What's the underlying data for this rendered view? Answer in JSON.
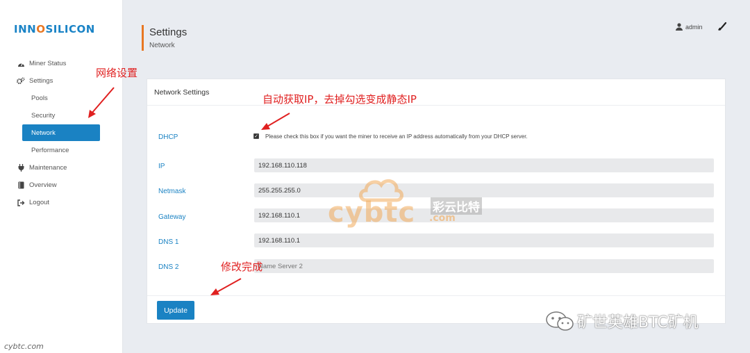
{
  "brand": {
    "logo_text": "INNOSILICON"
  },
  "sidebar": {
    "items": [
      {
        "label": "Miner Status",
        "icon": "dashboard-icon"
      },
      {
        "label": "Settings",
        "icon": "gears-icon"
      },
      {
        "label": "Pools"
      },
      {
        "label": "Security"
      },
      {
        "label": "Network",
        "active": true
      },
      {
        "label": "Performance"
      },
      {
        "label": "Maintenance",
        "icon": "plug-icon"
      },
      {
        "label": "Overview",
        "icon": "book-icon"
      },
      {
        "label": "Logout",
        "icon": "logout-icon"
      }
    ]
  },
  "header": {
    "title": "Settings",
    "subtitle": "Network",
    "user": "admin"
  },
  "card": {
    "title": "Network Settings",
    "dhcp": {
      "label": "DHCP",
      "checked": true,
      "help": "Please check this box if you want the miner to receive an IP address automatically from your DHCP server."
    },
    "fields": [
      {
        "label": "IP",
        "value": "192.168.110.118"
      },
      {
        "label": "Netmask",
        "value": "255.255.255.0"
      },
      {
        "label": "Gateway",
        "value": "192.168.110.1"
      },
      {
        "label": "DNS 1",
        "value": "192.168.110.1"
      },
      {
        "label": "DNS 2",
        "value": "",
        "placeholder": "Name Server 2"
      }
    ],
    "update_label": "Update"
  },
  "annotations": {
    "network_settings": "网络设置",
    "dhcp_note": "自动获取IP，去掉勾选变成静态IP",
    "done_note": "修改完成"
  },
  "watermarks": {
    "center_latin": "cybtc",
    "center_com": ".com",
    "center_cn": "彩云比特",
    "corner": "cybtc.com",
    "wechat": "矿世英雄BTC矿机"
  },
  "colors": {
    "accent": "#1a82c3",
    "header_bar": "#e87722",
    "annotation": "#e02020"
  }
}
